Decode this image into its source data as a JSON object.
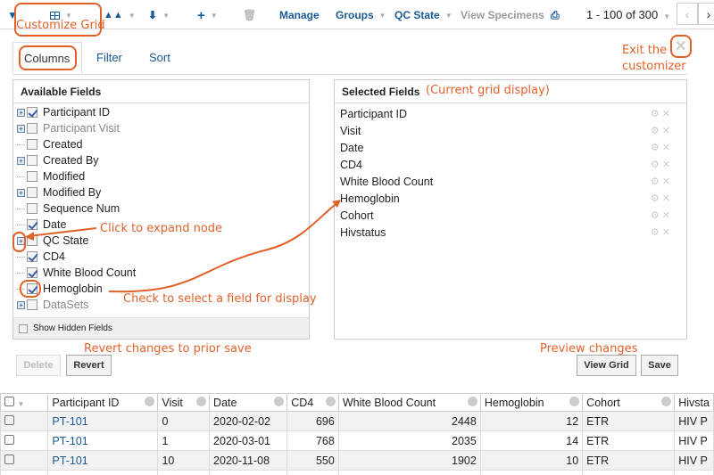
{
  "toolbar": {
    "grid_caret": "▼",
    "manage": "Manage",
    "groups": "Groups",
    "qc_state": "QC State",
    "view_specimens": "View Specimens",
    "paging": "1 - 100 of 300",
    "prev": "‹",
    "next": "›"
  },
  "annotations": {
    "customize_grid": "Customize Grid",
    "exit_line1": "Exit the",
    "exit_line2": "customizer",
    "current_grid": "(Current grid display)",
    "click_expand": "Click to expand node",
    "check_select": "Check to select a field for display",
    "revert_prior": "Revert changes to prior save",
    "preview": "Preview changes"
  },
  "tabs": [
    "Columns",
    "Filter",
    "Sort"
  ],
  "available": {
    "title": "Available Fields",
    "fields": [
      {
        "label": "Participant ID",
        "checked": true,
        "expandable": true,
        "muted": false
      },
      {
        "label": "Participant Visit",
        "checked": false,
        "expandable": true,
        "muted": true
      },
      {
        "label": "Created",
        "checked": false,
        "expandable": false,
        "muted": false
      },
      {
        "label": "Created By",
        "checked": false,
        "expandable": true,
        "muted": false
      },
      {
        "label": "Modified",
        "checked": false,
        "expandable": false,
        "muted": false
      },
      {
        "label": "Modified By",
        "checked": false,
        "expandable": true,
        "muted": false
      },
      {
        "label": "Sequence Num",
        "checked": false,
        "expandable": false,
        "muted": false
      },
      {
        "label": "Date",
        "checked": true,
        "expandable": false,
        "muted": false
      },
      {
        "label": "QC State",
        "checked": false,
        "expandable": true,
        "muted": false
      },
      {
        "label": "CD4",
        "checked": true,
        "expandable": false,
        "muted": false
      },
      {
        "label": "White Blood Count",
        "checked": true,
        "expandable": false,
        "muted": false
      },
      {
        "label": "Hemoglobin",
        "checked": true,
        "expandable": false,
        "muted": false
      },
      {
        "label": "DataSets",
        "checked": false,
        "expandable": true,
        "muted": true
      }
    ],
    "show_hidden": "Show Hidden Fields"
  },
  "selected": {
    "title": "Selected Fields",
    "fields": [
      "Participant ID",
      "Visit",
      "Date",
      "CD4",
      "White Blood Count",
      "Hemoglobin",
      "Cohort",
      "Hivstatus"
    ]
  },
  "buttons": {
    "delete": "Delete",
    "revert": "Revert",
    "view_grid": "View Grid",
    "save": "Save"
  },
  "grid": {
    "columns": [
      "Participant ID",
      "Visit",
      "Date",
      "CD4",
      "White Blood Count",
      "Hemoglobin",
      "Cohort",
      "Hivsta"
    ],
    "rows": [
      [
        "PT-101",
        "0",
        "2020-02-02",
        "696",
        "2448",
        "12",
        "ETR",
        "HIV P"
      ],
      [
        "PT-101",
        "1",
        "2020-03-01",
        "768",
        "2035",
        "14",
        "ETR",
        "HIV P"
      ],
      [
        "PT-101",
        "10",
        "2020-11-08",
        "550",
        "1902",
        "10",
        "ETR",
        "HIV P"
      ]
    ]
  },
  "colors": {
    "accent": "#1a5a96",
    "annotation": "#e0622a"
  }
}
